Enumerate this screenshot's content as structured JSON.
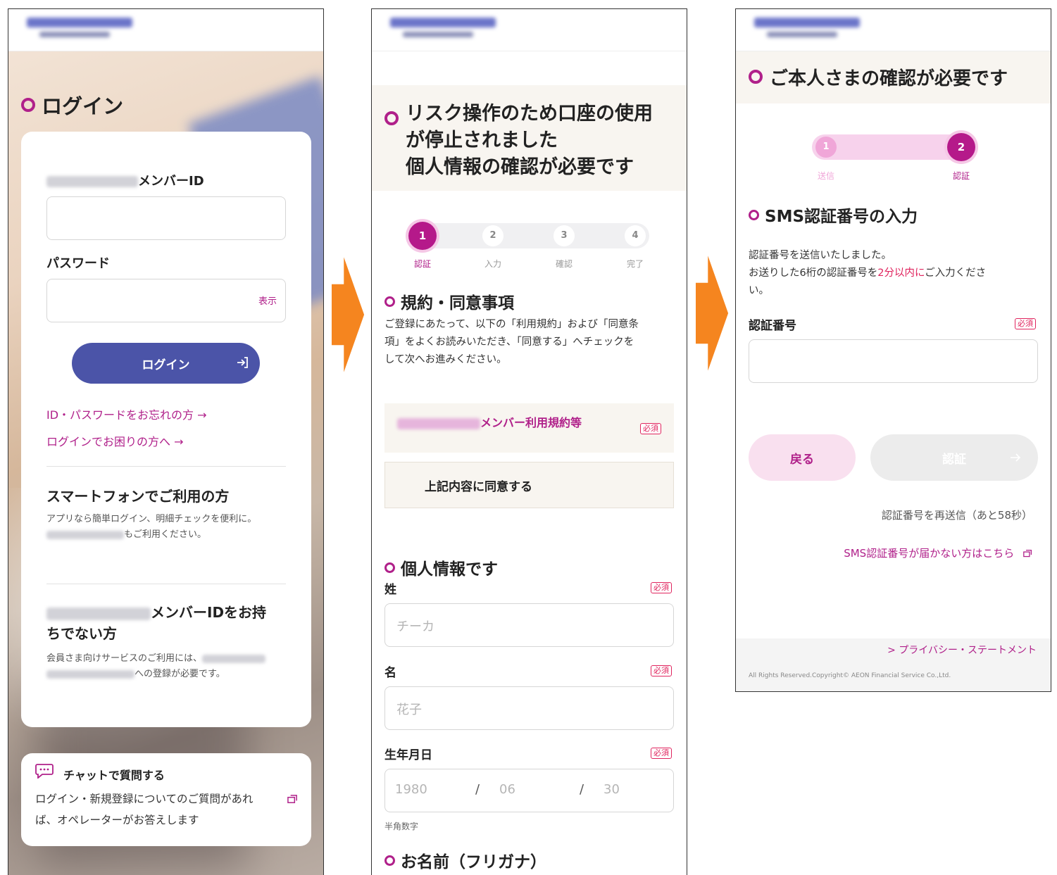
{
  "screen1": {
    "title": "ログイン",
    "member_id_label": "メンバーID",
    "password_label": "パスワード",
    "show_label": "表示",
    "login_button": "ログイン",
    "forgot_link": "ID・パスワードをお忘れの方 →",
    "trouble_link": "ログインでお困りの方へ →",
    "smartphone_heading": "スマートフォンでご利用の方",
    "smartphone_text1": "アプリなら簡単ログイン、明細チェックを便利に。",
    "smartphone_text2": "もご利用ください。",
    "no_id_heading_1": "メンバーIDをお持",
    "no_id_heading_2": "ちでない方",
    "no_id_text1": "会員さま向けサービスのご利用には、",
    "no_id_text2": "への登録が必要です。",
    "chat_heading": "チャットで質問する",
    "chat_text1": "ログイン・新規登録についてのご質問があれ",
    "chat_text2": "ば、オペレーターがお答えします"
  },
  "screen2": {
    "title_line1": "リスク操作のため口座の使用",
    "title_line2": "が停止されました",
    "title_line3": "個人情報の確認が必要です",
    "steps": [
      {
        "num": "1",
        "label": "認証"
      },
      {
        "num": "2",
        "label": "入力"
      },
      {
        "num": "3",
        "label": "確認"
      },
      {
        "num": "4",
        "label": "完了"
      }
    ],
    "terms_heading": "規約・同意事項",
    "terms_text1": "ご登録にあたって、以下の「利用規約」および「同意条",
    "terms_text2": "項」をよくお読みいただき、「同意する」へチェックを",
    "terms_text3": "して次へお進みください。",
    "terms_item": "メンバー利用規約等",
    "required": "必須",
    "agree_label": "上記内容に同意する",
    "personal_heading": "個人情報です",
    "last_name_label": "姓",
    "last_name_placeholder": "チーカ",
    "first_name_label": "名",
    "first_name_placeholder": "花子",
    "birth_label": "生年月日",
    "birth_year": "1980",
    "birth_month": "06",
    "birth_day": "30",
    "slash": "/",
    "halfwidth_note": "半角数字",
    "kana_heading": "お名前（フリガナ）"
  },
  "screen3": {
    "title": "ご本人さまの確認が必要です",
    "steps": [
      {
        "num": "1",
        "label": "送信"
      },
      {
        "num": "2",
        "label": "認証"
      }
    ],
    "sms_heading": "SMS認証番号の入力",
    "sent_text": "認証番号を送信いたしました。",
    "instruction_pre": "お送りした6桁の認証番号を",
    "instruction_highlight": "2分以内に",
    "instruction_post": "ご入力くださ",
    "instruction_end": "い。",
    "code_label": "認証番号",
    "required": "必須",
    "back_button": "戻る",
    "auth_button": "認証",
    "resend_text": "認証番号を再送信（あと58秒）",
    "sms_not_received_link": "SMS認証番号が届かない方はこちら",
    "privacy_link": "> プライバシー・ステートメント",
    "copyright": "All Rights Reserved.Copyright© AEON Financial Service Co.,Ltd."
  },
  "colors": {
    "accent": "#b0208a",
    "login_button": "#4b54a8",
    "arrow": "#f5851f",
    "required_red": "#e0245e"
  }
}
